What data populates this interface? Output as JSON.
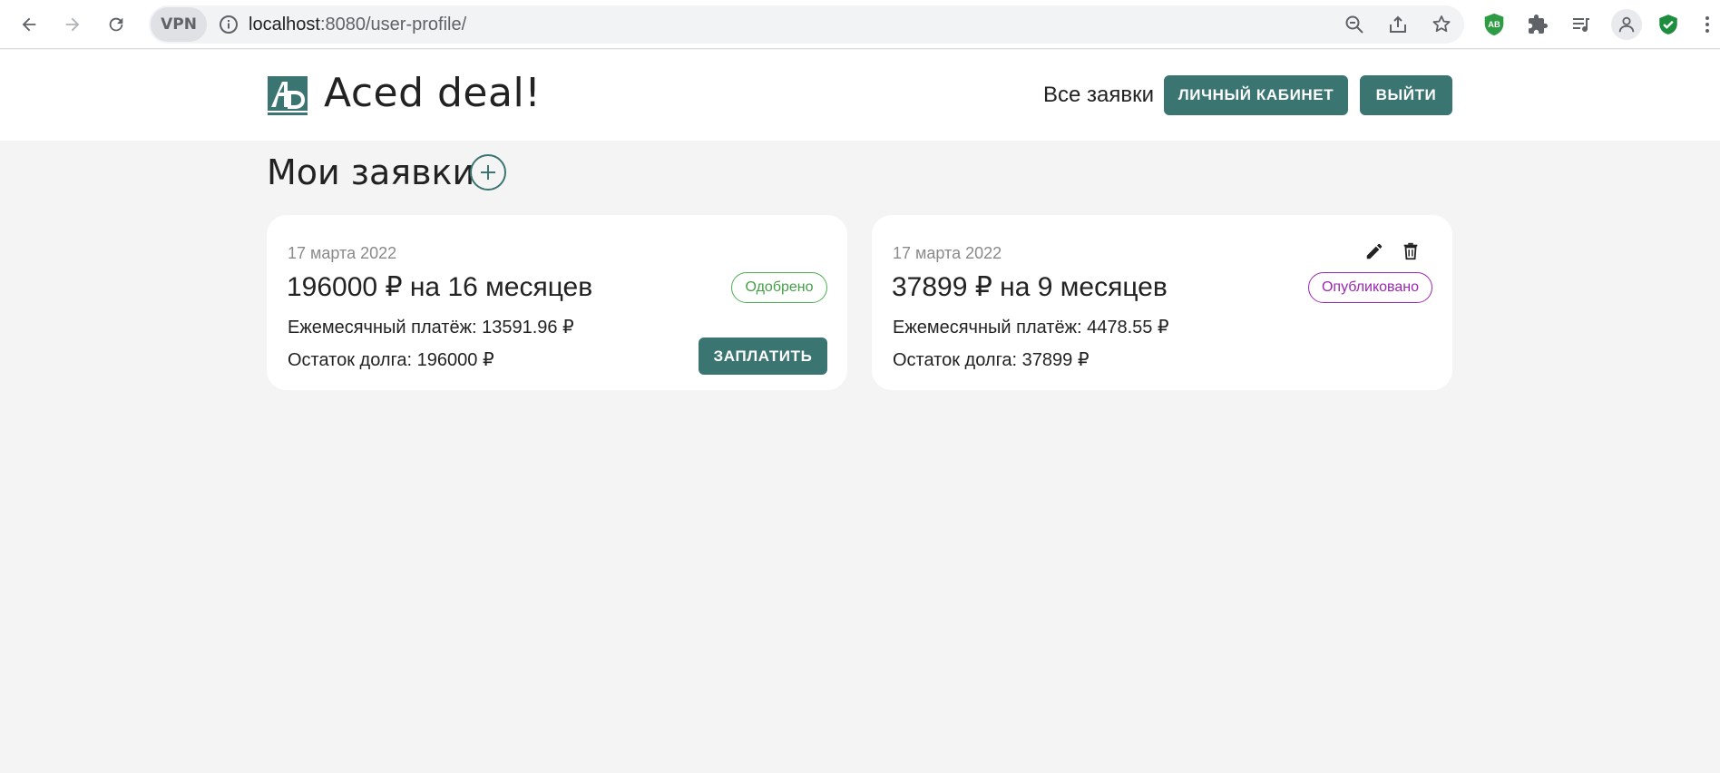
{
  "browser": {
    "vpn_label": "VPN",
    "url_host": "localhost",
    "url_path": ":8080/user-profile/",
    "extension_ab_label": "AB"
  },
  "header": {
    "brand": "Aced deal!",
    "nav_all_requests": "Все заявки",
    "cabinet_button": "ЛИЧНЫЙ КАБИНЕТ",
    "logout_button": "ВЫЙТИ"
  },
  "main": {
    "title": "Мои заявки",
    "cards": [
      {
        "date": "17 марта 2022",
        "amount": "196000 ₽ на 16 месяцев",
        "status": "Одобрено",
        "monthly": "Ежемесячный платёж: 13591.96 ₽",
        "remaining": "Остаток долга: 196000 ₽",
        "pay_button": "ЗАПЛАТИТЬ"
      },
      {
        "date": "17 марта 2022",
        "amount": "37899 ₽ на 9 месяцев",
        "status": "Опубликовано",
        "monthly": "Ежемесячный платёж: 4478.55 ₽",
        "remaining": "Остаток долга: 37899 ₽"
      }
    ]
  },
  "colors": {
    "accent": "#3a7572",
    "approved": "#43a047",
    "published": "#9c27b0",
    "background": "#f4f4f4"
  }
}
